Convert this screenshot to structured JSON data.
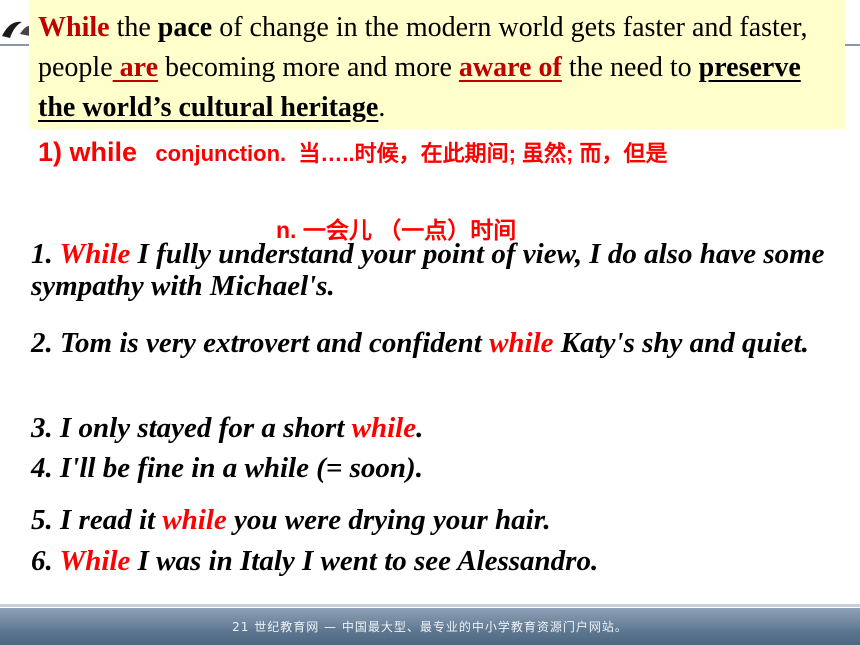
{
  "intro": {
    "w_while": "While",
    "t1": " the ",
    "w_pace": "pace",
    "t2": " of change in the modern world gets faster and faster, people",
    "w_are": " are",
    "t3": " becoming more and more ",
    "w_aware": "aware of",
    "t4": " the need to ",
    "w_preserve": "preserve the world’s cultural heritage",
    "t5": "."
  },
  "definition": {
    "number": "1) while",
    "pos": "conjunction.",
    "meanings": "当…..时候，在此期间; 虽然; 而，但是",
    "noun_line": "n.  一会儿 （一点）时间"
  },
  "examples": [
    {
      "pre": "1. ",
      "hl": "While",
      "post": " I fully understand your point of view, I do also have some sympathy with Michael's."
    },
    {
      "pre": "2. Tom is very extrovert and confident ",
      "hl": "while",
      "post": " Katy's shy and quiet."
    },
    {
      "pre": "3. I only stayed for a short ",
      "hl": "while",
      "post": "."
    },
    {
      "pre": "4. I'll be fine in a while (= soon).",
      "hl": "",
      "post": ""
    },
    {
      "pre": "5. I read it ",
      "hl": "while",
      "post": " you were drying your hair."
    },
    {
      "pre": "6. ",
      "hl": "While",
      "post": " I was in Italy I went to see Alessandro."
    }
  ],
  "footer": {
    "text": "21 世纪教育网 — 中国最大型、最专业的中小学教育资源门户网站。"
  },
  "colors": {
    "highlight_box": "#ffffcc",
    "keyword_red": "#ff0000",
    "footer_blue": "#5f7891"
  }
}
